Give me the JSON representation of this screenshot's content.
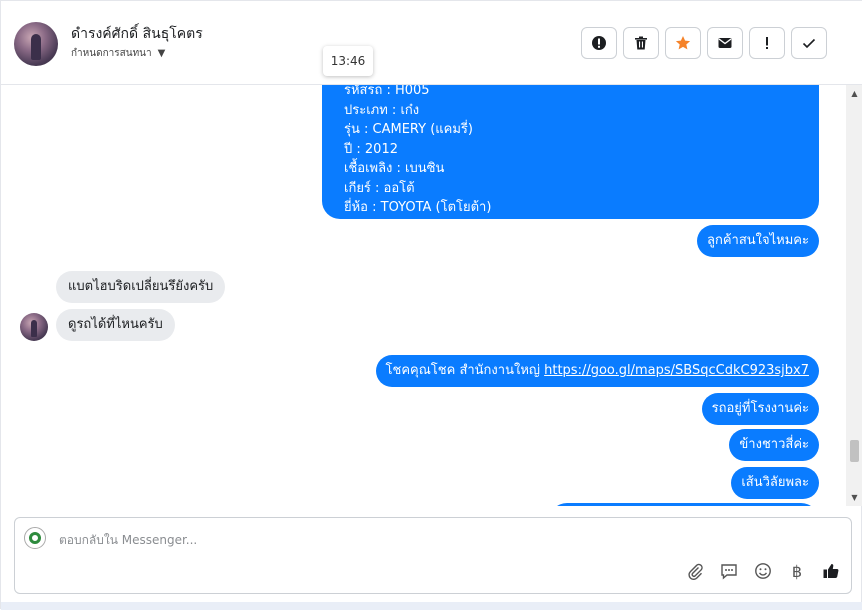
{
  "header": {
    "contact_name": "ดำรงค์ศักดิ์ สินธุโคตร",
    "assign_label": "กำหนดการสนทนา",
    "timestamp_tooltip": "13:46",
    "actions": [
      {
        "name": "report-spam",
        "icon": "alert-circle-icon"
      },
      {
        "name": "delete",
        "icon": "trash-icon"
      },
      {
        "name": "star",
        "icon": "star-icon"
      },
      {
        "name": "mark-unread",
        "icon": "envelope-icon"
      },
      {
        "name": "follow-up",
        "icon": "exclamation-icon"
      },
      {
        "name": "mark-done",
        "icon": "check-icon"
      }
    ]
  },
  "messages": {
    "card_lines": [
      "รหัสรถ : H005",
      "ประเภท : เก๋ง",
      "รุ่น : CAMERY (แคมรี่)",
      "ปี : 2012",
      "เชื้อเพลิง : เบนซิน",
      "เกียร์ : ออโต้",
      "ยี่ห้อ : TOYOTA (โตโยต้า)"
    ],
    "out_1": "ลูกค้าสนใจไหมคะ",
    "in_1": "แบตไฮบริดเปลี่ยนรึยังครับ",
    "in_2": "ดูรถได้ที่ไหนครับ",
    "out_2_text": "โชคคุณโชค สำนักงานใหญ่",
    "out_2_link": "https://goo.gl/maps/SBSqcCdkC923sjbx7",
    "out_3": "รถอยู่ที่โรงงานค่ะ",
    "out_4": "ข้างชาวสี่ค่ะ",
    "out_5": "เส้นวิลัยพละ"
  },
  "composer": {
    "placeholder": "ตอบกลับใน Messenger...",
    "tools": [
      "attachment-icon",
      "saved-reply-icon",
      "emoji-icon",
      "baht-icon",
      "thumbs-up-icon"
    ]
  },
  "colors": {
    "outgoing_bubble": "#0a7cff",
    "incoming_bubble": "#e9ebee",
    "star_accent": "#f5832a"
  }
}
